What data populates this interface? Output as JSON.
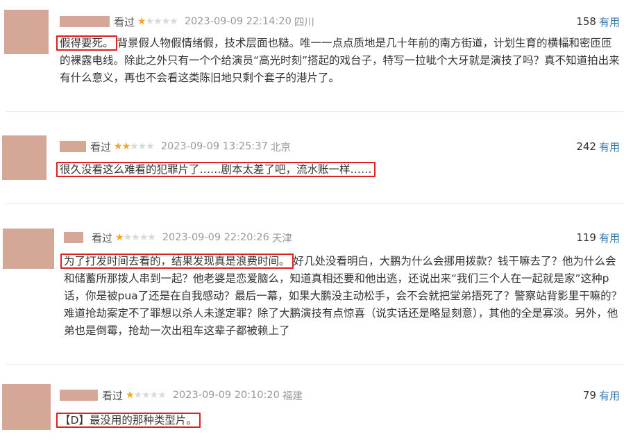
{
  "colors": {
    "redacted": "#d4a796",
    "star_on": "#f5a623",
    "star_off": "#d9d9d9",
    "link": "#3377aa",
    "highlight_box": "#e02020"
  },
  "reviews": [
    {
      "watched": "看过",
      "rating": 1,
      "date": "2023-09-09 22:14:20",
      "location": "四川",
      "votes": "158",
      "useful": "有用",
      "highlight": "假得要死。",
      "rest": "背景假人物假情绪假，技术层面也糙。唯一一点点质地是几十年前的南方街道，计划生育的横幅和密匝匝的裸露电线。除此之外只有一个个给演员“高光时刻”搭起的戏台子，特写一拉呲个大牙就是演技了吗？真不知道拍出来有什么意义，再也不会看这类陈旧地只剩个套子的港片了。"
    },
    {
      "watched": "看过",
      "rating": 2,
      "date": "2023-09-09 13:25:37",
      "location": "北京",
      "votes": "242",
      "useful": "有用",
      "highlight": "很久没看这么难看的犯罪片了……剧本太差了吧，流水账一样……",
      "rest": ""
    },
    {
      "watched": "看过",
      "rating": 1,
      "date": "2023-09-09 22:20:26",
      "location": "天津",
      "votes": "119",
      "useful": "有用",
      "highlight": "为了打发时间去看的，结果发现真是浪费时间。",
      "rest": "好几处没看明白，大鹏为什么会挪用拨款？钱干嘛去了？他为什么会和储蓄所那拨人串到一起？他老婆是恋爱脑么，知道真相还要和他出逃，还说出来“我们三个人在一起就是家”这种p话，你是被pua了还是在自我感动？最后一幕，如果大鹏没主动松手，会不会就把堂弟捂死了？警察站背影里干嘛的？难道抢劫案定不了罪想以杀人未遂定罪？除了大鹏演技有点惊喜（说实话还是略显刻意），其他的全是寡淡。另外，他弟也是倒霉，抢劫一次出租车这辈子都被赖上了"
    },
    {
      "watched": "看过",
      "rating": 1,
      "date": "2023-09-09 20:10:20",
      "location": "福建",
      "votes": "79",
      "useful": "有用",
      "highlight": "【D】最没用的那种类型片。",
      "rest": ""
    }
  ]
}
